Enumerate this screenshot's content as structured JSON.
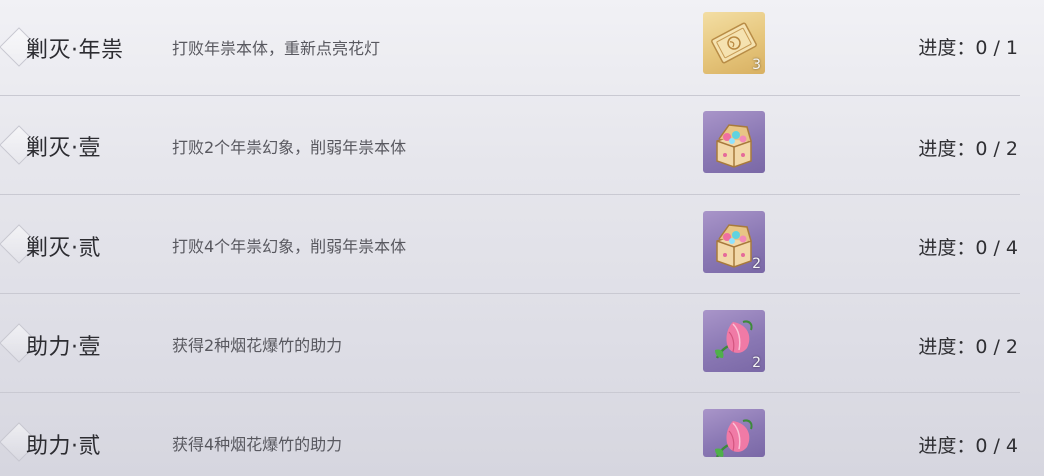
{
  "quests": [
    {
      "name": "剿灭·年祟",
      "desc": "打败年祟本体，重新点亮花灯",
      "reward_icon": "ticket-icon",
      "reward_count": "3",
      "progress_label": "进度：",
      "progress_value": "0 / 1"
    },
    {
      "name": "剿灭·壹",
      "desc": "打败2个年祟幻象，削弱年祟本体",
      "reward_icon": "treasure-chest-icon",
      "reward_count": "",
      "progress_label": "进度：",
      "progress_value": "0 / 2"
    },
    {
      "name": "剿灭·贰",
      "desc": "打败4个年祟幻象，削弱年祟本体",
      "reward_icon": "treasure-chest-icon",
      "reward_count": "2",
      "progress_label": "进度：",
      "progress_value": "0 / 4"
    },
    {
      "name": "助力·壹",
      "desc": "获得2种烟花爆竹的助力",
      "reward_icon": "flower-bud-icon",
      "reward_count": "2",
      "progress_label": "进度：",
      "progress_value": "0 / 2"
    },
    {
      "name": "助力·贰",
      "desc": "获得4种烟花爆竹的助力",
      "reward_icon": "flower-bud-icon",
      "reward_count": "",
      "progress_label": "进度：",
      "progress_value": "0 / 4"
    }
  ],
  "colors": {
    "gold_frame": "#e6c67c",
    "purple_frame": "#8a78b4"
  }
}
